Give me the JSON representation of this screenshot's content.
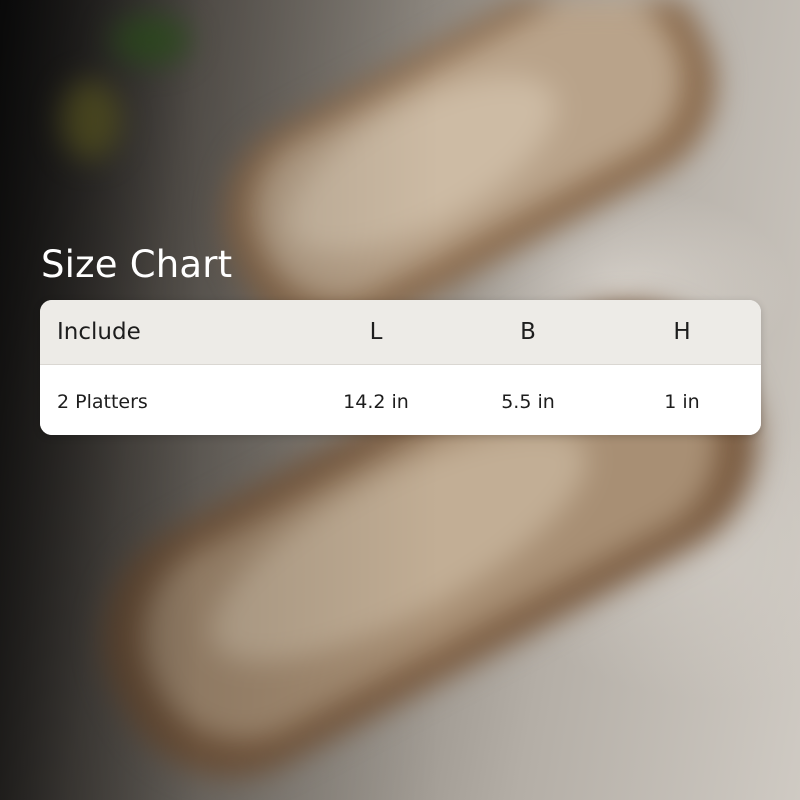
{
  "title": "Size Chart",
  "table": {
    "columns": [
      "Include",
      "L",
      "B",
      "H"
    ],
    "rows": [
      [
        "2 Platters",
        "14.2 in",
        "5.5 in",
        "1 in"
      ]
    ]
  },
  "colors": {
    "header_bg": "#edebe7",
    "row_bg": "#ffffff",
    "title_text": "#ffffff",
    "table_text": "#1d1d1d"
  }
}
